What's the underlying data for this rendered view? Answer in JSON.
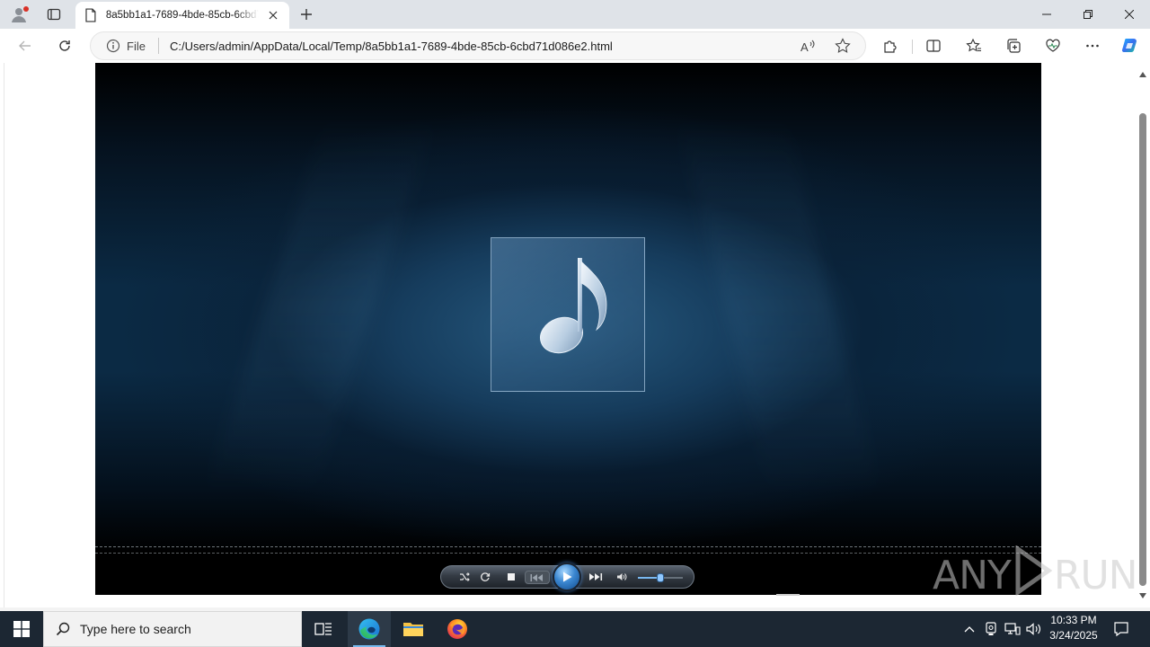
{
  "browser": {
    "tab": {
      "title": "8a5bb1a1-7689-4bde-85cb-6cbd71d086e2.html"
    },
    "address_bar": {
      "scheme_label": "File",
      "url": "C:/Users/admin/AppData/Local/Temp/8a5bb1a1-7689-4bde-85cb-6cbd71d086e2.html"
    }
  },
  "media_player": {
    "artwork_icon": "music-note-icon",
    "volume_level": 0.5,
    "controls": [
      "shuffle-icon",
      "repeat-icon",
      "stop-icon",
      "previous-icon",
      "play-icon",
      "next-icon",
      "volume-icon"
    ]
  },
  "watermark": {
    "left": "ANY",
    "right": "RUN"
  },
  "taskbar": {
    "search_placeholder": "Type here to search",
    "clock": {
      "time": "10:33 PM",
      "date": "3/24/2025"
    }
  },
  "colors": {
    "accent": "#0b2a44",
    "play_button": "#3a86d0",
    "taskbar": "#1c2733"
  }
}
